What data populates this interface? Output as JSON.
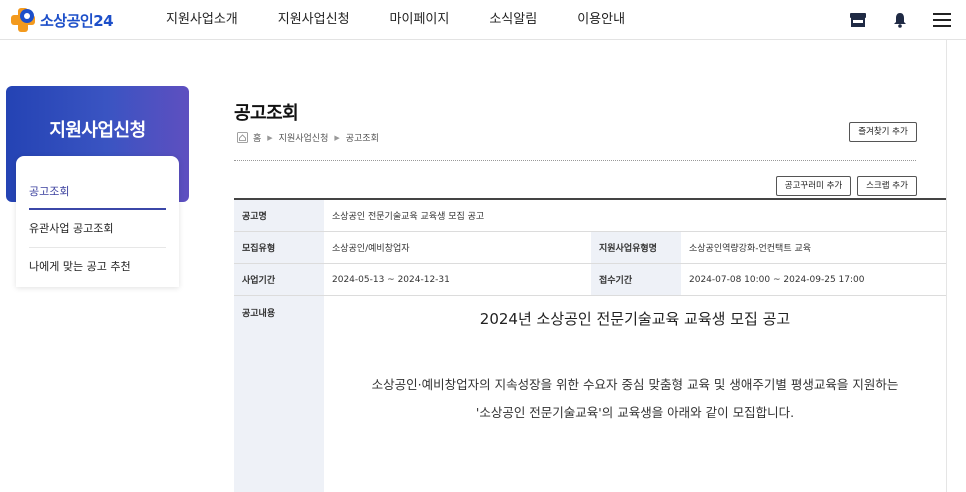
{
  "header": {
    "logo_text": "소상공인24",
    "nav": [
      "지원사업소개",
      "지원사업신청",
      "마이페이지",
      "소식알림",
      "이용안내"
    ],
    "icons": [
      "store-icon",
      "bell-icon",
      "hamburger-menu-icon"
    ]
  },
  "sidebar": {
    "banner_title": "지원사업신청",
    "items": [
      {
        "label": "공고조회",
        "active": true
      },
      {
        "label": "유관사업 공고조회",
        "active": false
      },
      {
        "label": "나에게 맞는 공고 추천",
        "active": false
      }
    ]
  },
  "main": {
    "title": "공고조회",
    "breadcrumb": [
      "홈",
      "지원사업신청",
      "공고조회"
    ],
    "fav_button": "즐겨찾기 추가",
    "collect_button": "공고꾸러미 추가",
    "scrap_button": "스크랩 추가",
    "table": {
      "notice_name_label": "공고명",
      "notice_name": "소상공인 전문기술교육 교육생 모집 공고",
      "recruit_type_label": "모집유형",
      "recruit_type": "소상공인/예비창업자",
      "support_type_label": "지원사업유형명",
      "support_type": "소상공인역량강화-언컨택트 교육",
      "biz_period_label": "사업기간",
      "biz_period": "2024-05-13 ~ 2024-12-31",
      "receipt_period_label": "접수기간",
      "receipt_period": "2024-07-08 10:00 ~ 2024-09-25 17:00",
      "content_label": "공고내용"
    },
    "content": {
      "title": "2024년 소상공인 전문기술교육 교육생 모집 공고",
      "line1": "소상공인·예비창업자의 지속성장을 위한 수요자 중심 맞춤형 교육 및 생애주기별 평생교육을 지원하는",
      "line2": "'소상공인 전문기술교육'의 교육생을 아래와 같이 모집합니다."
    }
  },
  "colors": {
    "brand_blue": "#1d4fc9",
    "logo_orange": "#f39a1e",
    "banner_start": "#2443b4",
    "banner_end": "#5e4fc0",
    "table_header_bg": "#eef1f7"
  }
}
